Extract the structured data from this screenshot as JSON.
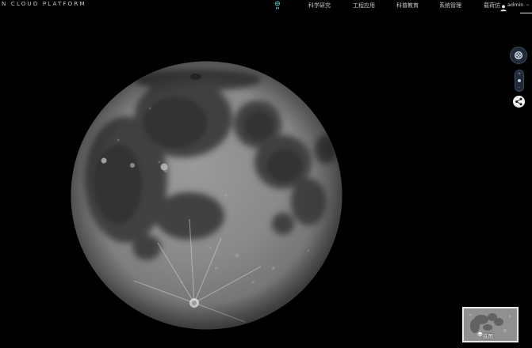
{
  "header": {
    "brand": "N CLOUD PLATFORM",
    "home_icon": "globe-home-icon",
    "nav": [
      {
        "label": "科学研究"
      },
      {
        "label": "工程应用"
      },
      {
        "label": "科普教育"
      },
      {
        "label": "系统管理"
      },
      {
        "label": "载荷仿"
      }
    ],
    "user": {
      "avatar_icon": "user-avatar-icon",
      "name": "admin",
      "caret": "⌄"
    }
  },
  "viewer": {
    "body": "moon",
    "colors": {
      "background": "#000000",
      "highland": "#8f8f8f",
      "mare": "#3a3a3a"
    }
  },
  "controls": {
    "compass_icon": "compass-icon",
    "zoom_plus": "+",
    "zoom_minus": "-",
    "share_icon": "share-icon"
  },
  "minimap": {
    "icon": "layers-icon",
    "label": "底图"
  }
}
